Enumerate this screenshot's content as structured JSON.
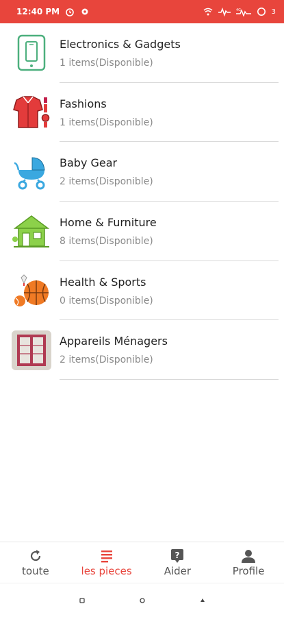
{
  "status": {
    "time": "12:40 PM",
    "battery_text": "3"
  },
  "categories": [
    {
      "name": "Electronics & Gadgets",
      "sub": "1 items(Disponible)",
      "icon": "tablet-icon"
    },
    {
      "name": "Fashions",
      "sub": "1 items(Disponible)",
      "icon": "clothing-icon"
    },
    {
      "name": "Baby Gear",
      "sub": "2 items(Disponible)",
      "icon": "stroller-icon"
    },
    {
      "name": "Home & Furniture",
      "sub": "8 items(Disponible)",
      "icon": "house-icon"
    },
    {
      "name": "Health & Sports",
      "sub": "0 items(Disponible)",
      "icon": "basketball-icon"
    },
    {
      "name": "Appareils Ménagers",
      "sub": "2 items(Disponible)",
      "icon": "wardrobe-photo"
    }
  ],
  "nav": [
    {
      "label": "toute",
      "icon": "refresh-icon",
      "active": false
    },
    {
      "label": "les pieces",
      "icon": "list-icon",
      "active": true
    },
    {
      "label": "Aider",
      "icon": "help-icon",
      "active": false
    },
    {
      "label": "Profile",
      "icon": "person-icon",
      "active": false
    }
  ],
  "colors": {
    "accent": "#e8453c",
    "divider": "#d9d9d9",
    "subtext": "#8a8a8a"
  }
}
